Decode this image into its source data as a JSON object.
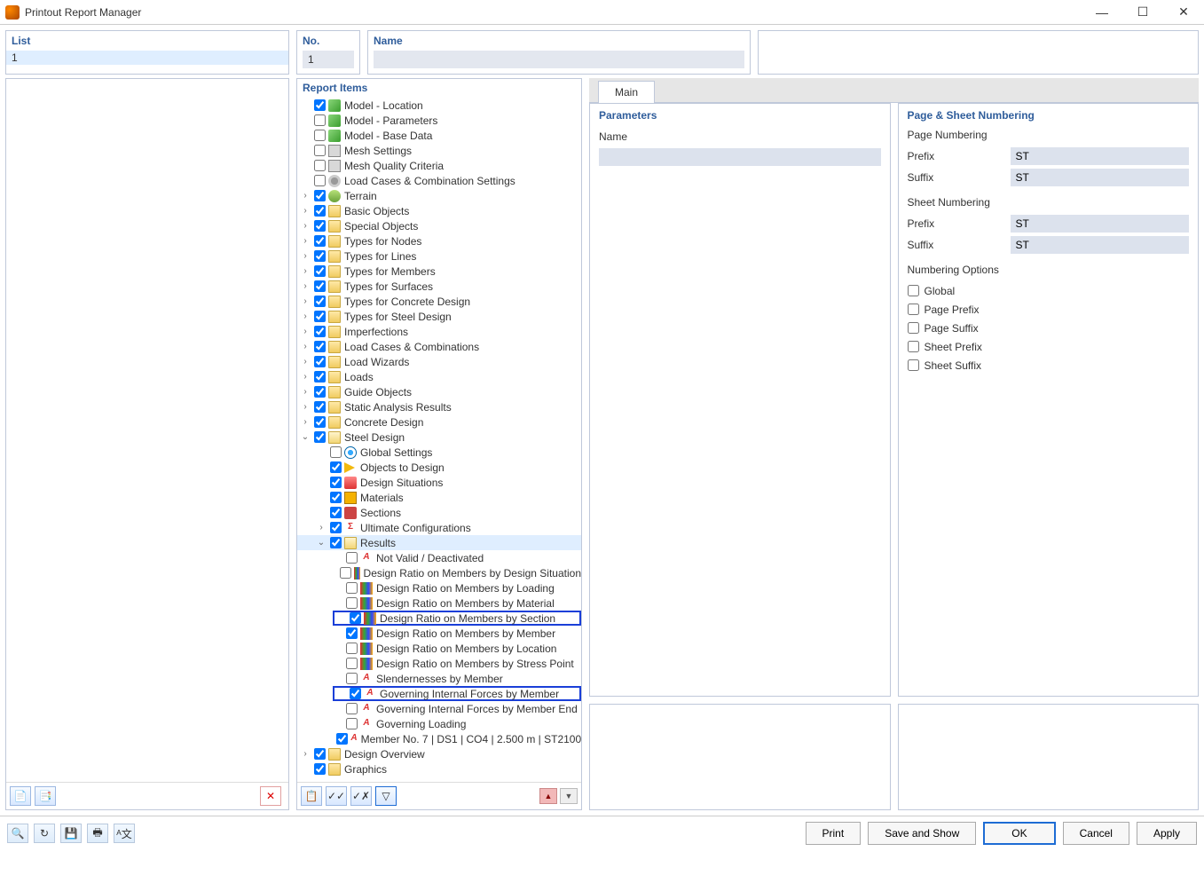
{
  "window": {
    "title": "Printout Report Manager"
  },
  "top": {
    "list": {
      "header": "List",
      "items": [
        "1"
      ]
    },
    "no": {
      "header": "No.",
      "value": "1"
    },
    "name": {
      "header": "Name",
      "value": ""
    }
  },
  "report_items": {
    "header": "Report Items",
    "tree": [
      {
        "indent": 0,
        "arrow": "",
        "checked": true,
        "icon": "model",
        "label": "Model - Location"
      },
      {
        "indent": 0,
        "arrow": "",
        "checked": false,
        "icon": "model",
        "label": "Model - Parameters"
      },
      {
        "indent": 0,
        "arrow": "",
        "checked": false,
        "icon": "model",
        "label": "Model - Base Data"
      },
      {
        "indent": 0,
        "arrow": "",
        "checked": false,
        "icon": "grid",
        "label": "Mesh Settings"
      },
      {
        "indent": 0,
        "arrow": "",
        "checked": false,
        "icon": "grid",
        "label": "Mesh Quality Criteria"
      },
      {
        "indent": 0,
        "arrow": "",
        "checked": false,
        "icon": "gear",
        "label": "Load Cases & Combination Settings"
      },
      {
        "indent": 0,
        "arrow": ">",
        "checked": true,
        "icon": "terrain",
        "label": "Terrain"
      },
      {
        "indent": 0,
        "arrow": ">",
        "checked": true,
        "icon": "folder",
        "label": "Basic Objects"
      },
      {
        "indent": 0,
        "arrow": ">",
        "checked": true,
        "icon": "folder",
        "label": "Special Objects"
      },
      {
        "indent": 0,
        "arrow": ">",
        "checked": true,
        "icon": "folder",
        "label": "Types for Nodes"
      },
      {
        "indent": 0,
        "arrow": ">",
        "checked": true,
        "icon": "folder",
        "label": "Types for Lines"
      },
      {
        "indent": 0,
        "arrow": ">",
        "checked": true,
        "icon": "folder",
        "label": "Types for Members"
      },
      {
        "indent": 0,
        "arrow": ">",
        "checked": true,
        "icon": "folder",
        "label": "Types for Surfaces"
      },
      {
        "indent": 0,
        "arrow": ">",
        "checked": true,
        "icon": "folder",
        "label": "Types for Concrete Design"
      },
      {
        "indent": 0,
        "arrow": ">",
        "checked": true,
        "icon": "folder",
        "label": "Types for Steel Design"
      },
      {
        "indent": 0,
        "arrow": ">",
        "checked": true,
        "icon": "folder",
        "label": "Imperfections"
      },
      {
        "indent": 0,
        "arrow": ">",
        "checked": true,
        "icon": "folder",
        "label": "Load Cases & Combinations"
      },
      {
        "indent": 0,
        "arrow": ">",
        "checked": true,
        "icon": "folder",
        "label": "Load Wizards"
      },
      {
        "indent": 0,
        "arrow": ">",
        "checked": true,
        "icon": "folder",
        "label": "Loads"
      },
      {
        "indent": 0,
        "arrow": ">",
        "checked": true,
        "icon": "folder",
        "label": "Guide Objects"
      },
      {
        "indent": 0,
        "arrow": ">",
        "checked": true,
        "icon": "folder",
        "label": "Static Analysis Results"
      },
      {
        "indent": 0,
        "arrow": ">",
        "checked": true,
        "icon": "folder",
        "label": "Concrete Design"
      },
      {
        "indent": 0,
        "arrow": "v",
        "checked": true,
        "icon": "folder-open",
        "label": "Steel Design"
      },
      {
        "indent": 1,
        "arrow": "",
        "checked": false,
        "icon": "globe",
        "label": "Global Settings"
      },
      {
        "indent": 1,
        "arrow": "",
        "checked": true,
        "icon": "tri",
        "label": "Objects to Design"
      },
      {
        "indent": 1,
        "arrow": "",
        "checked": true,
        "icon": "red",
        "label": "Design Situations"
      },
      {
        "indent": 1,
        "arrow": "",
        "checked": true,
        "icon": "cubes",
        "label": "Materials"
      },
      {
        "indent": 1,
        "arrow": "",
        "checked": true,
        "icon": "shape",
        "label": "Sections"
      },
      {
        "indent": 1,
        "arrow": ">",
        "checked": true,
        "icon": "sigma",
        "label": "Ultimate Configurations"
      },
      {
        "indent": 1,
        "arrow": "v",
        "checked": true,
        "icon": "folder-open",
        "label": "Results",
        "sel": true
      },
      {
        "indent": 2,
        "arrow": "",
        "checked": false,
        "icon": "redA",
        "label": "Not Valid / Deactivated"
      },
      {
        "indent": 2,
        "arrow": "",
        "checked": false,
        "icon": "bars",
        "label": "Design Ratio on Members by Design Situation"
      },
      {
        "indent": 2,
        "arrow": "",
        "checked": false,
        "icon": "bars",
        "label": "Design Ratio on Members by Loading"
      },
      {
        "indent": 2,
        "arrow": "",
        "checked": false,
        "icon": "bars",
        "label": "Design Ratio on Members by Material"
      },
      {
        "indent": 2,
        "arrow": "",
        "checked": true,
        "icon": "bars",
        "label": "Design Ratio on Members by Section",
        "hl": true
      },
      {
        "indent": 2,
        "arrow": "",
        "checked": true,
        "icon": "bars",
        "label": "Design Ratio on Members by Member"
      },
      {
        "indent": 2,
        "arrow": "",
        "checked": false,
        "icon": "bars",
        "label": "Design Ratio on Members by Location"
      },
      {
        "indent": 2,
        "arrow": "",
        "checked": false,
        "icon": "bars",
        "label": "Design Ratio on Members by Stress Point"
      },
      {
        "indent": 2,
        "arrow": "",
        "checked": false,
        "icon": "redA",
        "label": "Slendernesses by Member"
      },
      {
        "indent": 2,
        "arrow": "",
        "checked": true,
        "icon": "redA",
        "label": "Governing Internal Forces by Member",
        "hl": true
      },
      {
        "indent": 2,
        "arrow": "",
        "checked": false,
        "icon": "redA",
        "label": "Governing Internal Forces by Member End"
      },
      {
        "indent": 2,
        "arrow": "",
        "checked": false,
        "icon": "redA",
        "label": "Governing Loading"
      },
      {
        "indent": 2,
        "arrow": "",
        "checked": true,
        "icon": "redA",
        "label": "Member No. 7 | DS1 | CO4 | 2.500 m | ST2100"
      },
      {
        "indent": 0,
        "arrow": ">",
        "checked": true,
        "icon": "folder",
        "label": "Design Overview"
      },
      {
        "indent": 0,
        "arrow": "",
        "checked": true,
        "icon": "folder",
        "label": "Graphics"
      }
    ]
  },
  "main_tab": "Main",
  "parameters": {
    "header": "Parameters",
    "name_label": "Name",
    "name_value": ""
  },
  "numbering": {
    "header": "Page & Sheet Numbering",
    "page_numbering_label": "Page Numbering",
    "sheet_numbering_label": "Sheet Numbering",
    "prefix_label": "Prefix",
    "suffix_label": "Suffix",
    "page_prefix": "ST",
    "page_suffix": "ST",
    "sheet_prefix": "ST",
    "sheet_suffix": "ST",
    "options_label": "Numbering Options",
    "options": [
      {
        "label": "Global",
        "checked": false
      },
      {
        "label": "Page Prefix",
        "checked": false
      },
      {
        "label": "Page Suffix",
        "checked": false
      },
      {
        "label": "Sheet Prefix",
        "checked": false
      },
      {
        "label": "Sheet Suffix",
        "checked": false
      }
    ]
  },
  "footer": {
    "print": "Print",
    "save_show": "Save and Show",
    "ok": "OK",
    "cancel": "Cancel",
    "apply": "Apply"
  }
}
